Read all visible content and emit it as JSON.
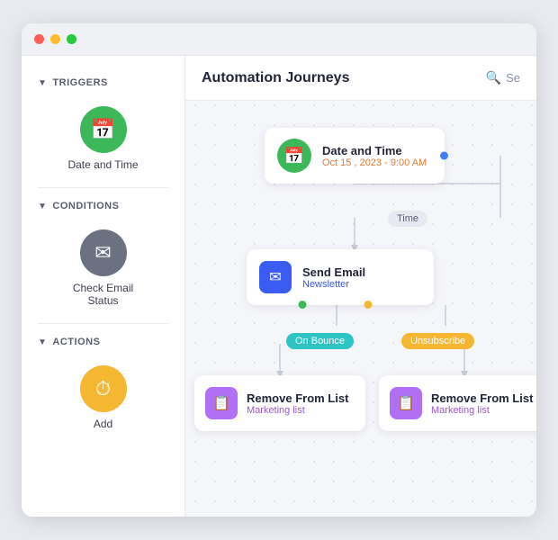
{
  "window": {
    "dots": [
      "red",
      "yellow",
      "green"
    ]
  },
  "header": {
    "title": "Automation Journeys",
    "search_placeholder": "Se..."
  },
  "sidebar": {
    "sections": [
      {
        "id": "triggers",
        "label": "TRIGGERS",
        "items": [
          {
            "id": "date-and-time",
            "label": "Date and Time",
            "icon": "📅",
            "style": "green"
          }
        ]
      },
      {
        "id": "conditions",
        "label": "CONDITIONS",
        "items": [
          {
            "id": "check-email-status",
            "label": "Check Email\nStatus",
            "icon": "✉",
            "style": "gray"
          }
        ]
      },
      {
        "id": "actions",
        "label": "ACTIONS",
        "items": [
          {
            "id": "add",
            "label": "Add",
            "icon": "⏱",
            "style": "yellow"
          }
        ]
      }
    ]
  },
  "canvas": {
    "nodes": {
      "trigger": {
        "title": "Date and Time",
        "subtitle": "Oct 15 , 2023 - 9:00 AM"
      },
      "time_badge": "Time",
      "send_email": {
        "title": "Send Email",
        "subtitle": "Newsletter"
      },
      "badge_bounce": "On Bounce",
      "badge_unsubscribe": "Unsubscribe",
      "remove_left": {
        "title": "Remove From List",
        "subtitle": "Marketing list"
      },
      "remove_right": {
        "title": "Remove From List",
        "subtitle": "Marketing list"
      }
    }
  }
}
